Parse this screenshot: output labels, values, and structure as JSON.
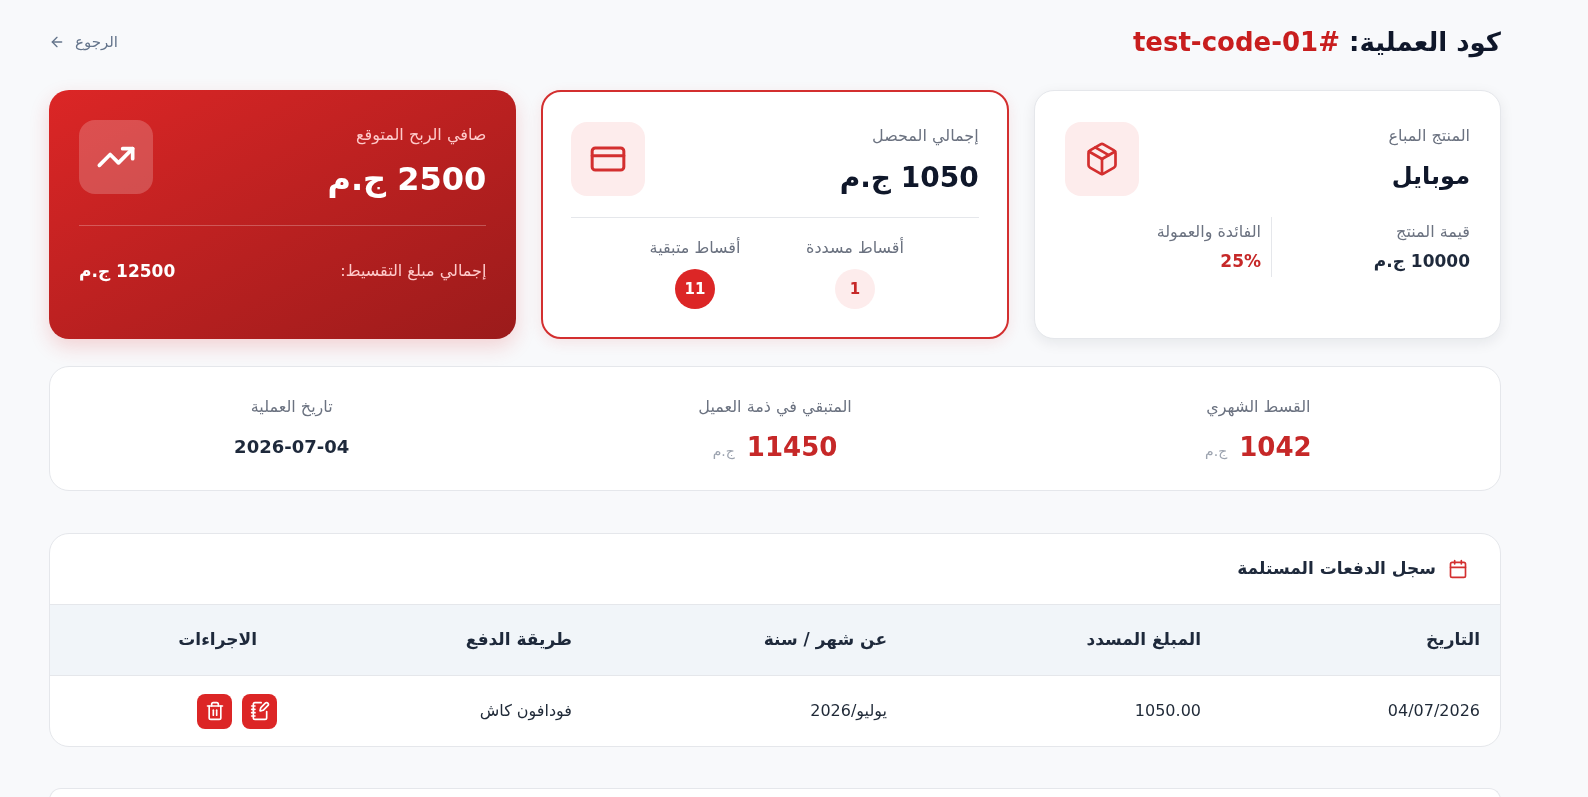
{
  "header": {
    "title_label": "كود العملية:",
    "code": "#test-code-01",
    "back_link": "الرجوع"
  },
  "product_card": {
    "label": "المنتج المباع",
    "name": "موبايل",
    "details": [
      {
        "label": "قيمة المنتج",
        "value": "10000 ج.م",
        "kind": "amount"
      },
      {
        "label": "الفائدة والعمولة",
        "value": "25%",
        "kind": "percent"
      }
    ]
  },
  "collected_card": {
    "label": "إجمالي المحصل",
    "value": "1050 ج.م",
    "counts": [
      {
        "label": "أقساط مسددة",
        "count": "1",
        "kind": "paid"
      },
      {
        "label": "أقساط متبقية",
        "count": "11",
        "kind": "remaining"
      }
    ]
  },
  "profit_card": {
    "label": "صافي الربح المتوقع",
    "value": "2500 ج.م",
    "total_label": "إجمالي مبلغ التقسيط:",
    "total_value": "12500 ج.م"
  },
  "summary": {
    "items": [
      {
        "label": "القسط الشهري",
        "value": "1042",
        "currency": "ج.م",
        "kind": "money"
      },
      {
        "label": "المتبقي في ذمة العميل",
        "value": "11450",
        "currency": "ج.م",
        "kind": "money"
      },
      {
        "label": "تاريخ العملية",
        "value": "2026-07-04",
        "kind": "date"
      }
    ]
  },
  "payments": {
    "title": "سجل الدفعات المستلمة",
    "columns": [
      "التاريخ",
      "المبلغ المسدد",
      "عن شهر / سنة",
      "طريقة الدفع",
      "الاجراءات"
    ],
    "rows": [
      {
        "date": "04/07/2026",
        "amount": "1050.00",
        "period": "يوليو/2026",
        "method": "فودافون كاش"
      }
    ]
  }
}
